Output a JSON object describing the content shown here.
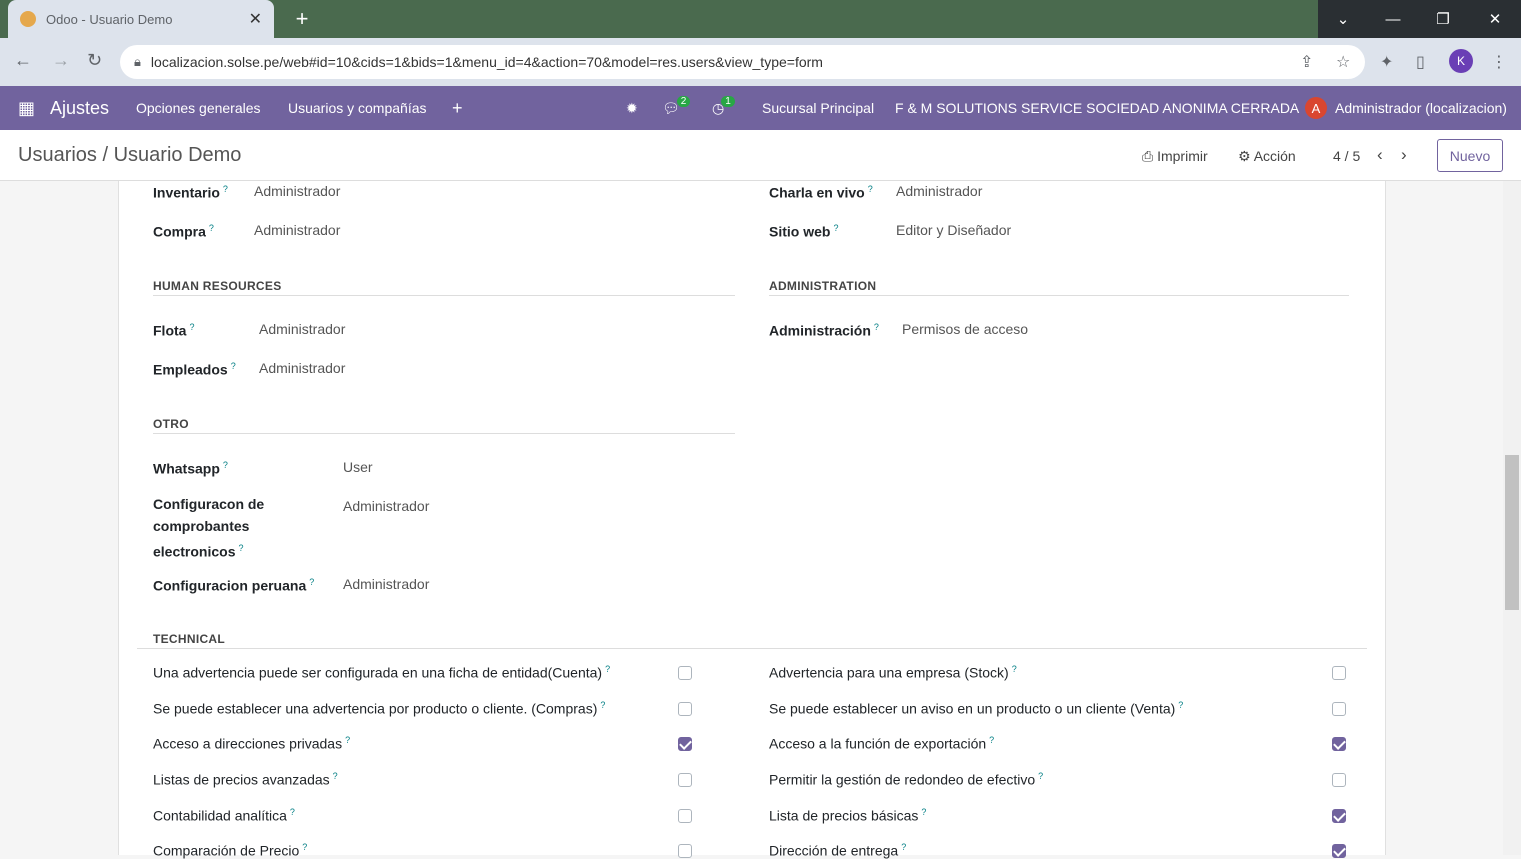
{
  "browser": {
    "tab_title": "Odoo - Usuario Demo",
    "url": "localizacion.solse.pe/web#id=10&cids=1&bids=1&menu_id=4&action=70&model=res.users&view_type=form",
    "profile_initial": "K"
  },
  "navbar": {
    "app": "Ajustes",
    "menu": [
      "Opciones generales",
      "Usuarios y compañías"
    ],
    "messages_count": "2",
    "activities_count": "1",
    "branch": "Sucursal Principal",
    "company": "F & M SOLUTIONS SERVICE SOCIEDAD ANONIMA CERRADA",
    "user_initial": "A",
    "user": "Administrador (localizacion)"
  },
  "control_panel": {
    "breadcrumb_parent": "Usuarios",
    "breadcrumb_sep": "/",
    "breadcrumb_current": "Usuario Demo",
    "print": "Imprimir",
    "action": "Acción",
    "pager": "4 / 5",
    "new": "Nuevo"
  },
  "form": {
    "top_left": [
      {
        "label": "Inventario",
        "value": "Administrador"
      },
      {
        "label": "Compra",
        "value": "Administrador"
      }
    ],
    "top_right": [
      {
        "label": "Charla en vivo",
        "value": "Administrador"
      },
      {
        "label": "Sitio web",
        "value": "Editor y Diseñador"
      }
    ],
    "hr_title": "HUMAN RESOURCES",
    "hr": [
      {
        "label": "Flota",
        "value": "Administrador"
      },
      {
        "label": "Empleados",
        "value": "Administrador"
      }
    ],
    "admin_title": "ADMINISTRATION",
    "admin": [
      {
        "label": "Administración",
        "value": "Permisos de acceso"
      }
    ],
    "otro_title": "OTRO",
    "otro": [
      {
        "label": "Whatsapp",
        "value": "User"
      },
      {
        "label_lines": [
          "Configuracon de",
          "comprobantes",
          "electronicos"
        ],
        "value": "Administrador"
      },
      {
        "label": "Configuracion peruana",
        "value": "Administrador"
      }
    ],
    "technical_title": "TECHNICAL",
    "technical_left": [
      {
        "label": "Una advertencia puede ser configurada en una ficha de entidad(Cuenta)",
        "checked": false
      },
      {
        "label": "Se puede establecer una advertencia por producto o cliente. (Compras)",
        "checked": false
      },
      {
        "label": "Acceso a direcciones privadas",
        "checked": true
      },
      {
        "label": "Listas de precios avanzadas",
        "checked": false
      },
      {
        "label": "Contabilidad analítica",
        "checked": false
      },
      {
        "label": "Comparación de Precio",
        "checked": false
      }
    ],
    "technical_right": [
      {
        "label": "Advertencia para una empresa (Stock)",
        "checked": false
      },
      {
        "label": "Se puede establecer un aviso en un producto o un cliente (Venta)",
        "checked": false
      },
      {
        "label": "Acceso a la función de exportación",
        "checked": true
      },
      {
        "label": "Permitir la gestión de redondeo de efectivo",
        "checked": false
      },
      {
        "label": "Lista de precios básicas",
        "checked": true
      },
      {
        "label": "Dirección de entrega",
        "checked": true
      }
    ],
    "help_mark": "?"
  }
}
